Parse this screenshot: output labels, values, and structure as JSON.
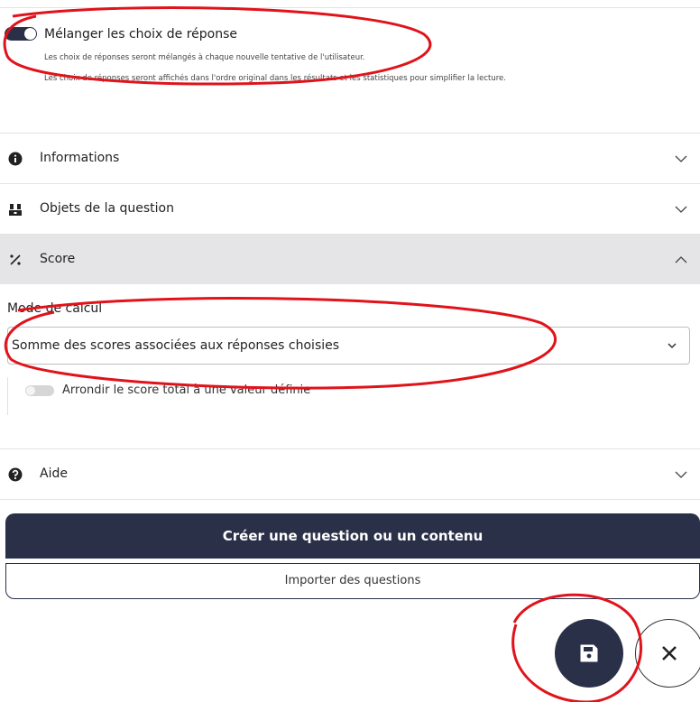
{
  "shuffle": {
    "title": "Mélanger les choix de réponse",
    "desc1": "Les choix de réponses seront mélangés à chaque nouvelle tentative de l'utilisateur.",
    "desc2": "Les choix de réponses seront affichés dans l'ordre original dans les résultats et les statistiques pour simplifier la lecture.",
    "enabled": true
  },
  "accordion": [
    {
      "label": "Informations",
      "icon": "info-icon",
      "expanded": false
    },
    {
      "label": "Objets de la question",
      "icon": "objects-icon",
      "expanded": false
    },
    {
      "label": "Score",
      "icon": "percent-icon",
      "expanded": true
    },
    {
      "label": "Aide",
      "icon": "help-icon",
      "expanded": false
    }
  ],
  "score": {
    "mode_label": "Mode de calcul",
    "mode_value": "Somme des scores associées aux réponses choisies",
    "round_label": "Arrondir le score total à une valeur définie",
    "round_enabled": false
  },
  "buttons": {
    "create": "Créer une question ou un contenu",
    "import": "Importer des questions"
  },
  "colors": {
    "primary": "#2b3049",
    "annotation": "#e0131b",
    "active_row": "#e5e5e7"
  }
}
